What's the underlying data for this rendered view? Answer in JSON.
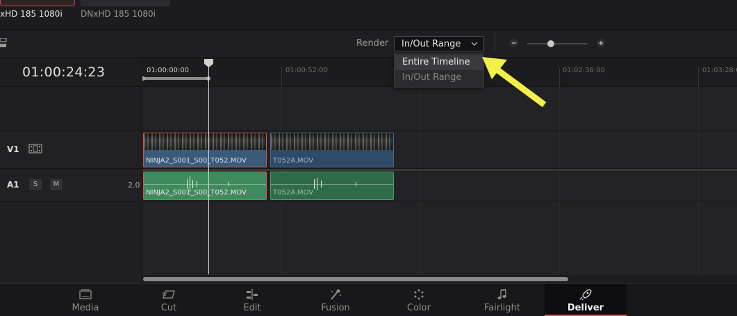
{
  "source_clips": {
    "clip1_label": "xHD 185 1080i",
    "clip2_label": "DNxHD 185 1080i"
  },
  "toolbar": {
    "render_label": "Render",
    "render_value": "In/Out Range",
    "zoom_level": 0.4
  },
  "render_menu": {
    "items": [
      "Entire Timeline",
      "In/Out Range"
    ],
    "highlighted": "Entire Timeline"
  },
  "timeline": {
    "timecode": "01:00:24:23",
    "ruler_ticks": [
      "01:00:00:00",
      "01:00:52:00",
      "01:02:36:00",
      "01:03:28:0"
    ],
    "tracks": {
      "v1": {
        "name": "V1"
      },
      "a1": {
        "name": "A1",
        "solo": "S",
        "mute": "M",
        "channels": "2.0"
      }
    },
    "video_clips": [
      {
        "label": "NINJA2_S001_S00_T052.MOV"
      },
      {
        "label": "T052A.MOV"
      }
    ],
    "audio_clips": [
      {
        "label": "NINJA2_S001_S00_T052.MOV"
      },
      {
        "label": "T052A.MOV"
      }
    ]
  },
  "page_nav": {
    "items": [
      {
        "label": "Media",
        "icon": "media-icon"
      },
      {
        "label": "Cut",
        "icon": "cut-icon"
      },
      {
        "label": "Edit",
        "icon": "edit-icon"
      },
      {
        "label": "Fusion",
        "icon": "fusion-icon"
      },
      {
        "label": "Color",
        "icon": "color-icon"
      },
      {
        "label": "Fairlight",
        "icon": "fairlight-icon"
      },
      {
        "label": "Deliver",
        "icon": "deliver-icon"
      }
    ],
    "active": "Deliver"
  },
  "colors": {
    "accent_red": "#d8545a",
    "video_clip": "#3b5a7a",
    "audio_clip": "#3f8a5e",
    "annotation_arrow": "#f3f04a"
  }
}
